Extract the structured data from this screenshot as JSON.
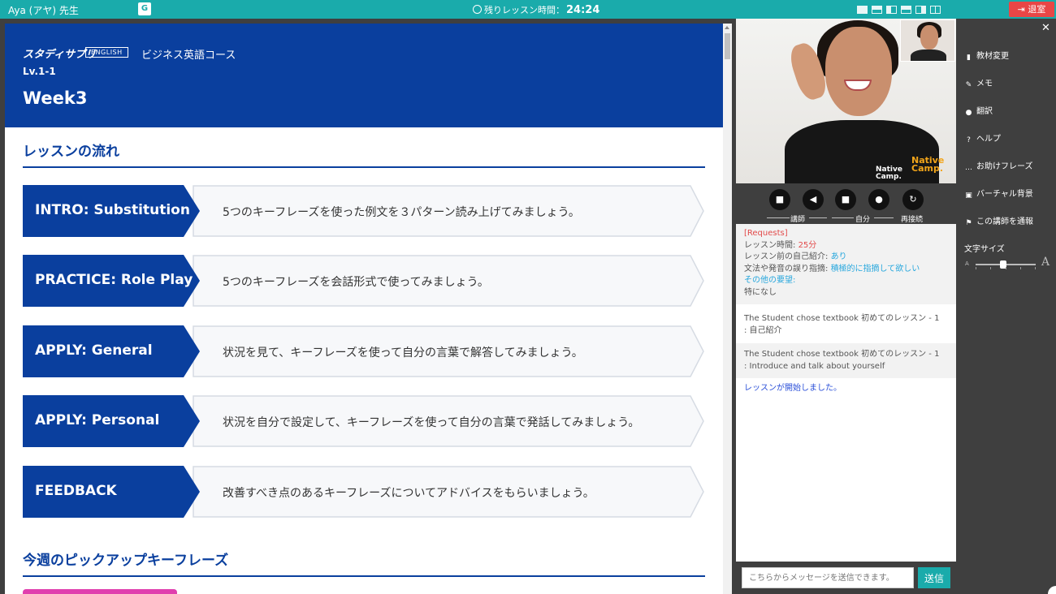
{
  "topbar": {
    "teacher": "Aya (アヤ) 先生",
    "timer_label": "残りレッスン時間：",
    "timer_value": "24:24",
    "exit_label": "退室",
    "translate_icon": "G"
  },
  "textbook": {
    "brand": "スタディサプリ",
    "badge": "ENGLISH",
    "course": "ビジネス英語コース",
    "level": "Lv.1-1",
    "week": "Week3",
    "section1_title": "レッスンの流れ",
    "steps": [
      {
        "label": "INTRO: Substitution",
        "desc": "5つのキーフレーズを使った例文を３パターン読み上げてみましょう。"
      },
      {
        "label": "PRACTICE: Role Play",
        "desc": "5つのキーフレーズを会話形式で使ってみましょう。"
      },
      {
        "label": "APPLY: General",
        "desc": "状況を見て、キーフレーズを使って自分の言葉で解答してみましょう。"
      },
      {
        "label": "APPLY: Personal",
        "desc": "状況を自分で設定して、キーフレーズを使って自分の言葉で発話してみましょう。"
      },
      {
        "label": "FEEDBACK",
        "desc": "改善すべき点のあるキーフレーズについてアドバイスをもらいましょう。"
      }
    ],
    "section2_title": "今週のピックアップキーフレーズ"
  },
  "video": {
    "logo_top": "Native",
    "logo_bottom": "Camp.",
    "controls": {
      "teacher_label": "講師",
      "self_label": "自分",
      "reconnect_label": "再接続"
    }
  },
  "chat": {
    "requests_header": "[Requests]",
    "lesson_time_label": "レッスン時間:",
    "lesson_time_value": "25分",
    "intro_label": "レッスン前の自己紹介:",
    "intro_value": "あり",
    "correction_label": "文法や発音の誤り指摘:",
    "correction_value": "積極的に指摘して欲しい",
    "other_label": "その他の要望:",
    "other_value": "特になし",
    "messages": [
      {
        "line1": "The Student chose textbook 初めてのレッスン - 1",
        "line2": ": 自己紹介"
      },
      {
        "line1": "The Student chose textbook 初めてのレッスン - 1",
        "line2": ": Introduce and talk about yourself"
      }
    ],
    "system_message": "レッスンが開始しました。",
    "input_placeholder": "こちらからメッセージを送信できます。",
    "send_label": "送信"
  },
  "sidebar": {
    "items": [
      {
        "label": "教材変更",
        "icon": "book-icon"
      },
      {
        "label": "メモ",
        "icon": "edit-icon"
      },
      {
        "label": "翻訳",
        "icon": "globe-icon"
      },
      {
        "label": "ヘルプ",
        "icon": "question-icon"
      },
      {
        "label": "お助けフレーズ",
        "icon": "chat-bubble-icon"
      },
      {
        "label": "バーチャル背景",
        "icon": "image-icon"
      },
      {
        "label": "この講師を通報",
        "icon": "flag-icon"
      }
    ],
    "font_size_label": "文字サイズ",
    "font_small": "A",
    "font_large": "A",
    "font_size_level": 0.45
  },
  "colors": {
    "teal": "#1aabab",
    "navy": "#0a3f9e",
    "exit_red": "#e94646",
    "dark_panel": "#3f3f3f"
  }
}
